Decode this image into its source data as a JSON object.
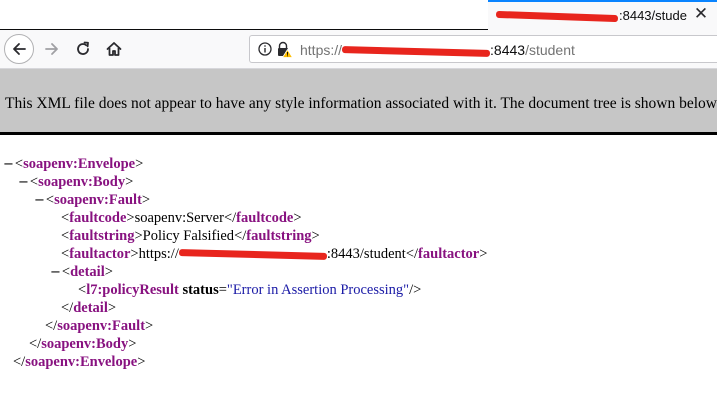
{
  "browser": {
    "tab": {
      "title_suffix": ":8443/stude",
      "close_glyph": "✕"
    },
    "url": {
      "scheme": "https://",
      "host_suffix": ":8443",
      "path": "/student"
    },
    "icons": {
      "back": "arrow-left-icon",
      "forward": "arrow-right-icon",
      "reload": "reload-icon",
      "home": "home-icon",
      "info": "info-icon",
      "lock": "lock-warning-icon"
    }
  },
  "xml_notice": "This XML file does not appear to have any style information associated with it. The document tree is shown below.",
  "xml": {
    "toggle": "−",
    "envelope_tag": "soapenv:Envelope",
    "body_tag": "soapenv:Body",
    "fault_tag": "soapenv:Fault",
    "faultcode_tag": "faultcode",
    "faultcode_value": "soapenv:Server",
    "faultstring_tag": "faultstring",
    "faultstring_value": "Policy Falsified",
    "faultactor_tag": "faultactor",
    "faultactor_scheme": "https://",
    "faultactor_suffix": ":8443/student",
    "detail_tag": "detail",
    "policy_tag": "l7:policyResult",
    "status_attr": "status",
    "status_value": "\"Error in Assertion Processing\""
  },
  "colors": {
    "tag": "#881280",
    "attr_value": "#1a1aa6",
    "redaction": "#e8251d",
    "active_tab_accent": "#0a84ff"
  }
}
